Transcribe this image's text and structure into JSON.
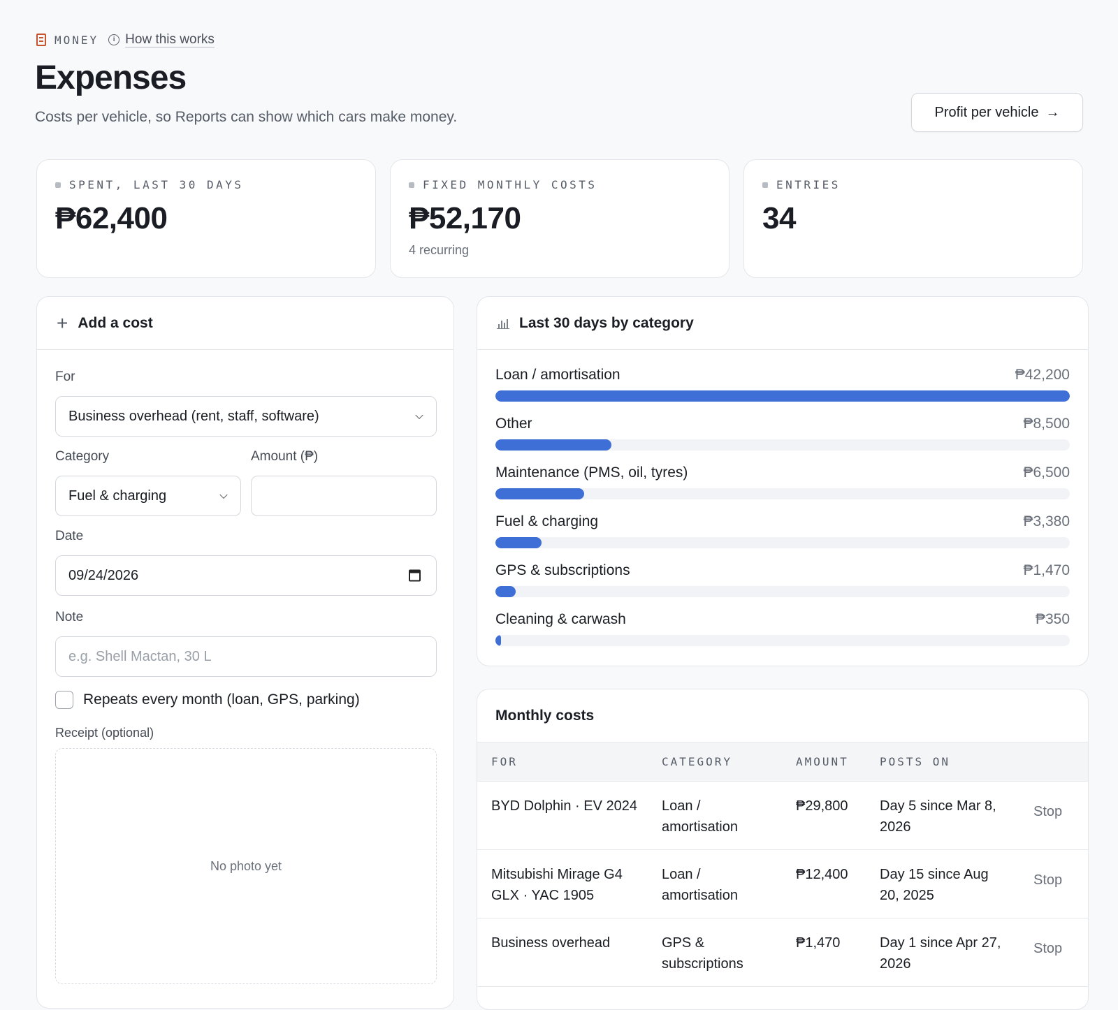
{
  "header": {
    "section": "MONEY",
    "help_link": "How this works",
    "title": "Expenses",
    "subtitle": "Costs per vehicle, so Reports can show which cars make money.",
    "profit_button": "Profit per vehicle",
    "profit_arrow": "→"
  },
  "stats": [
    {
      "label": "SPENT, LAST 30 DAYS",
      "value": "₱62,400",
      "sub": ""
    },
    {
      "label": "FIXED MONTHLY COSTS",
      "value": "₱52,170",
      "sub": "4 recurring"
    },
    {
      "label": "ENTRIES",
      "value": "34",
      "sub": ""
    }
  ],
  "add_cost": {
    "title": "Add a cost",
    "for_label": "For",
    "for_value": "Business overhead (rent, staff, software)",
    "category_label": "Category",
    "category_value": "Fuel & charging",
    "amount_label": "Amount (₱)",
    "amount_value": "",
    "date_label": "Date",
    "date_value": "09/24/2026",
    "note_label": "Note",
    "note_placeholder": "e.g. Shell Mactan, 30 L",
    "repeat_label": "Repeats every month (loan, GPS, parking)",
    "repeat_checked": false,
    "receipt_label": "Receipt (optional)",
    "receipt_empty": "No photo yet"
  },
  "categories_card": {
    "title": "Last 30 days by category"
  },
  "chart_data": {
    "type": "bar",
    "categories": [
      "Loan / amortisation",
      "Other",
      "Maintenance (PMS, oil, tyres)",
      "Fuel & charging",
      "GPS & subscriptions",
      "Cleaning & carwash"
    ],
    "values": [
      42200,
      8500,
      6500,
      3380,
      1470,
      350
    ],
    "labels": [
      "₱42,200",
      "₱8,500",
      "₱6,500",
      "₱3,380",
      "₱1,470",
      "₱350"
    ],
    "orientation": "horizontal",
    "color": "#3e6fd6"
  },
  "monthly": {
    "title": "Monthly costs",
    "columns": [
      "FOR",
      "CATEGORY",
      "AMOUNT",
      "POSTS ON"
    ],
    "rows": [
      {
        "for": "BYD Dolphin · EV 2024",
        "category": "Loan / amortisation",
        "amount": "₱29,800",
        "posts_on": "Day 5 since Mar 8, 2026",
        "action": "Stop"
      },
      {
        "for": "Mitsubishi Mirage G4 GLX · YAC 1905",
        "category": "Loan / amortisation",
        "amount": "₱12,400",
        "posts_on": "Day 15 since Aug 20, 2025",
        "action": "Stop"
      },
      {
        "for": "Business overhead",
        "category": "GPS & subscriptions",
        "amount": "₱1,470",
        "posts_on": "Day 1 since Apr 27, 2026",
        "action": "Stop"
      }
    ]
  },
  "colors": {
    "accent": "#3e6fd6",
    "brand_icon": "#c6532e",
    "background": "#f8f9fb"
  }
}
